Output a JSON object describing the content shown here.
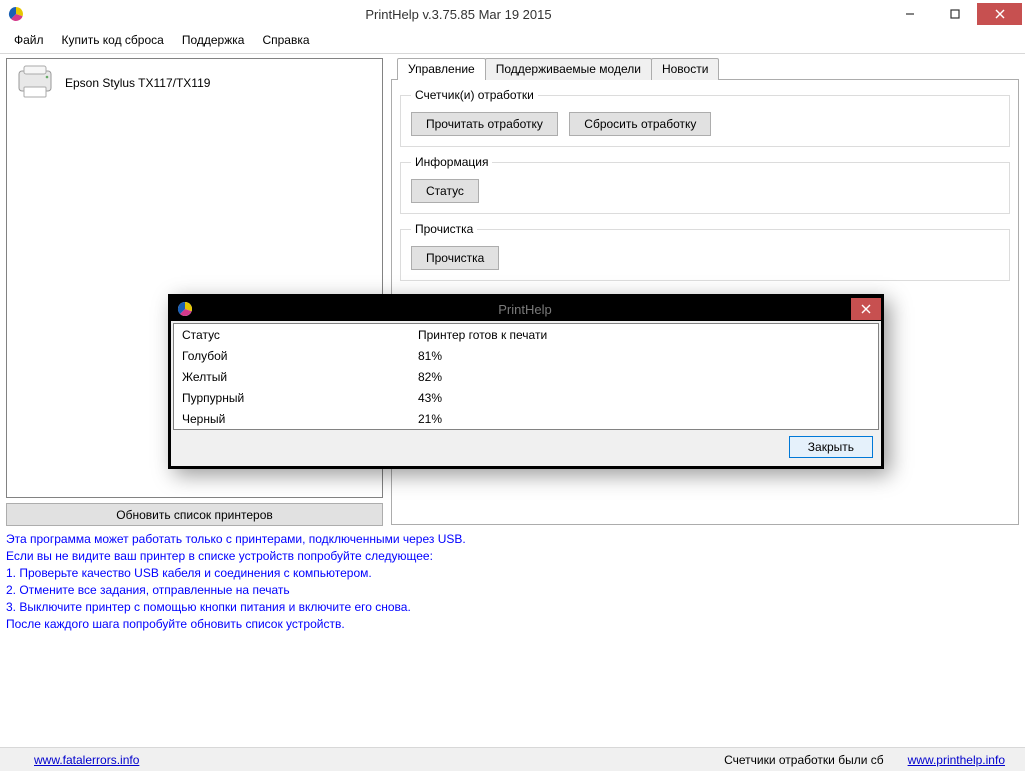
{
  "window": {
    "title": "PrintHelp v.3.75.85 Mar 19 2015"
  },
  "menu": {
    "file": "Файл",
    "buy": "Купить код сброса",
    "support": "Поддержка",
    "help": "Справка"
  },
  "left": {
    "printer_name": "Epson Stylus TX117/TX119",
    "refresh_label": "Обновить список принтеров"
  },
  "tabs": {
    "control": "Управление",
    "models": "Поддерживаемые модели",
    "news": "Новости"
  },
  "groups": {
    "counters": {
      "legend": "Счетчик(и) отработки",
      "read_btn": "Прочитать отработку",
      "reset_btn": "Сбросить отработку"
    },
    "info": {
      "legend": "Информация",
      "status_btn": "Статус"
    },
    "clean": {
      "legend": "Прочистка",
      "clean_btn": "Прочистка"
    }
  },
  "info": {
    "l1": "Эта программа может работать только с принтерами, подключенными через USB.",
    "l2": "Если вы не видите ваш принтер в списке устройств попробуйте следующее:",
    "l3": "1. Проверьте качество USB кабеля и соединения с компьютером.",
    "l4": "2. Отмените все задания, отправленные на печать",
    "l5": "3. Выключите принтер с помощью кнопки питания и включите его снова.",
    "l6": "После каждого шага попробуйте обновить список устройств."
  },
  "status": {
    "left_link": "www.fatalerrors.info",
    "mid": "Счетчики отработки были сб",
    "right_link": "www.printhelp.info"
  },
  "modal": {
    "title": "PrintHelp",
    "rows": [
      {
        "k": "Статус",
        "v": "Принтер готов к печати"
      },
      {
        "k": "Голубой",
        "v": "81%"
      },
      {
        "k": "Желтый",
        "v": "82%"
      },
      {
        "k": "Пурпурный",
        "v": "43%"
      },
      {
        "k": "Черный",
        "v": "21%"
      }
    ],
    "close_btn": "Закрыть"
  }
}
